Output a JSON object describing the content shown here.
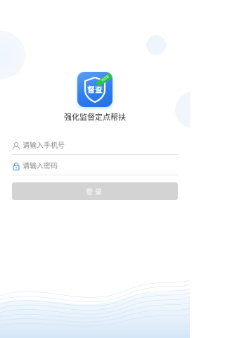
{
  "app": {
    "logo_text": "督查",
    "logo_badge": "WEB",
    "title": "强化监督定点帮扶"
  },
  "form": {
    "phone": {
      "placeholder": "请输入手机号",
      "value": "",
      "icon": "user-icon"
    },
    "password": {
      "placeholder": "请输入密码",
      "value": "",
      "icon": "lock-icon"
    },
    "login_label": "登录"
  },
  "colors": {
    "accent": "#2f7ef0",
    "badge": "#2fc24b",
    "button_disabled": "#d3d3d3",
    "icon_blue": "#3b82e0"
  }
}
